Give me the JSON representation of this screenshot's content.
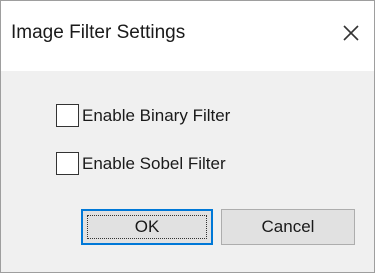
{
  "window": {
    "title": "Image Filter Settings",
    "close_icon": "close-icon"
  },
  "options": [
    {
      "label": "Enable Binary Filter",
      "checked": false
    },
    {
      "label": "Enable Sobel Filter",
      "checked": false
    }
  ],
  "buttons": {
    "ok_label": "OK",
    "cancel_label": "Cancel"
  },
  "colors": {
    "accent": "#0078d7",
    "dialog_background": "#f0f0f0",
    "titlebar_background": "#ffffff"
  }
}
